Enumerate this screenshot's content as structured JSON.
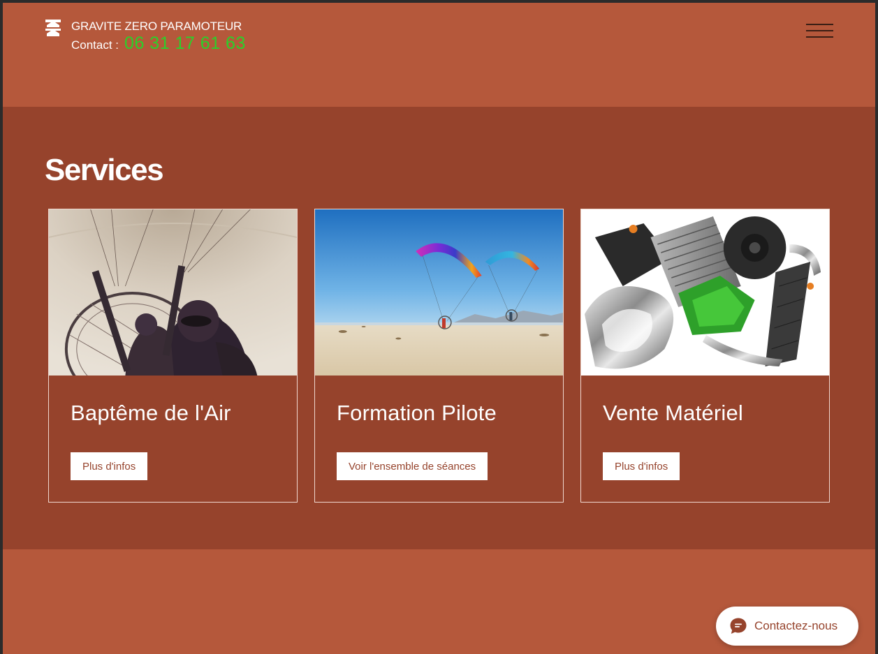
{
  "header": {
    "brand_title": "GRAVITE ZERO PARAMOTEUR",
    "contact_label": "Contact :",
    "contact_phone": "06 31 17 61 63",
    "menu_icon": "hamburger-menu-icon"
  },
  "services": {
    "title": "Services",
    "cards": [
      {
        "title": "Baptême de l'Air",
        "button": "Plus d'infos",
        "image": "tandem-paramotor-flight-photo"
      },
      {
        "title": "Formation Pilote",
        "button": "Voir l'ensemble de séances",
        "image": "paragliders-over-beach-photo"
      },
      {
        "title": "Vente Matériel",
        "button": "Plus d'infos",
        "image": "paramotor-engine-photo"
      }
    ]
  },
  "chat": {
    "label": "Contactez-nous",
    "icon": "chat-bubble-icon"
  },
  "colors": {
    "header_bg": "#b5583b",
    "section_bg": "#96432c",
    "phone_green": "#2ad12a",
    "button_bg": "#ffffff"
  }
}
